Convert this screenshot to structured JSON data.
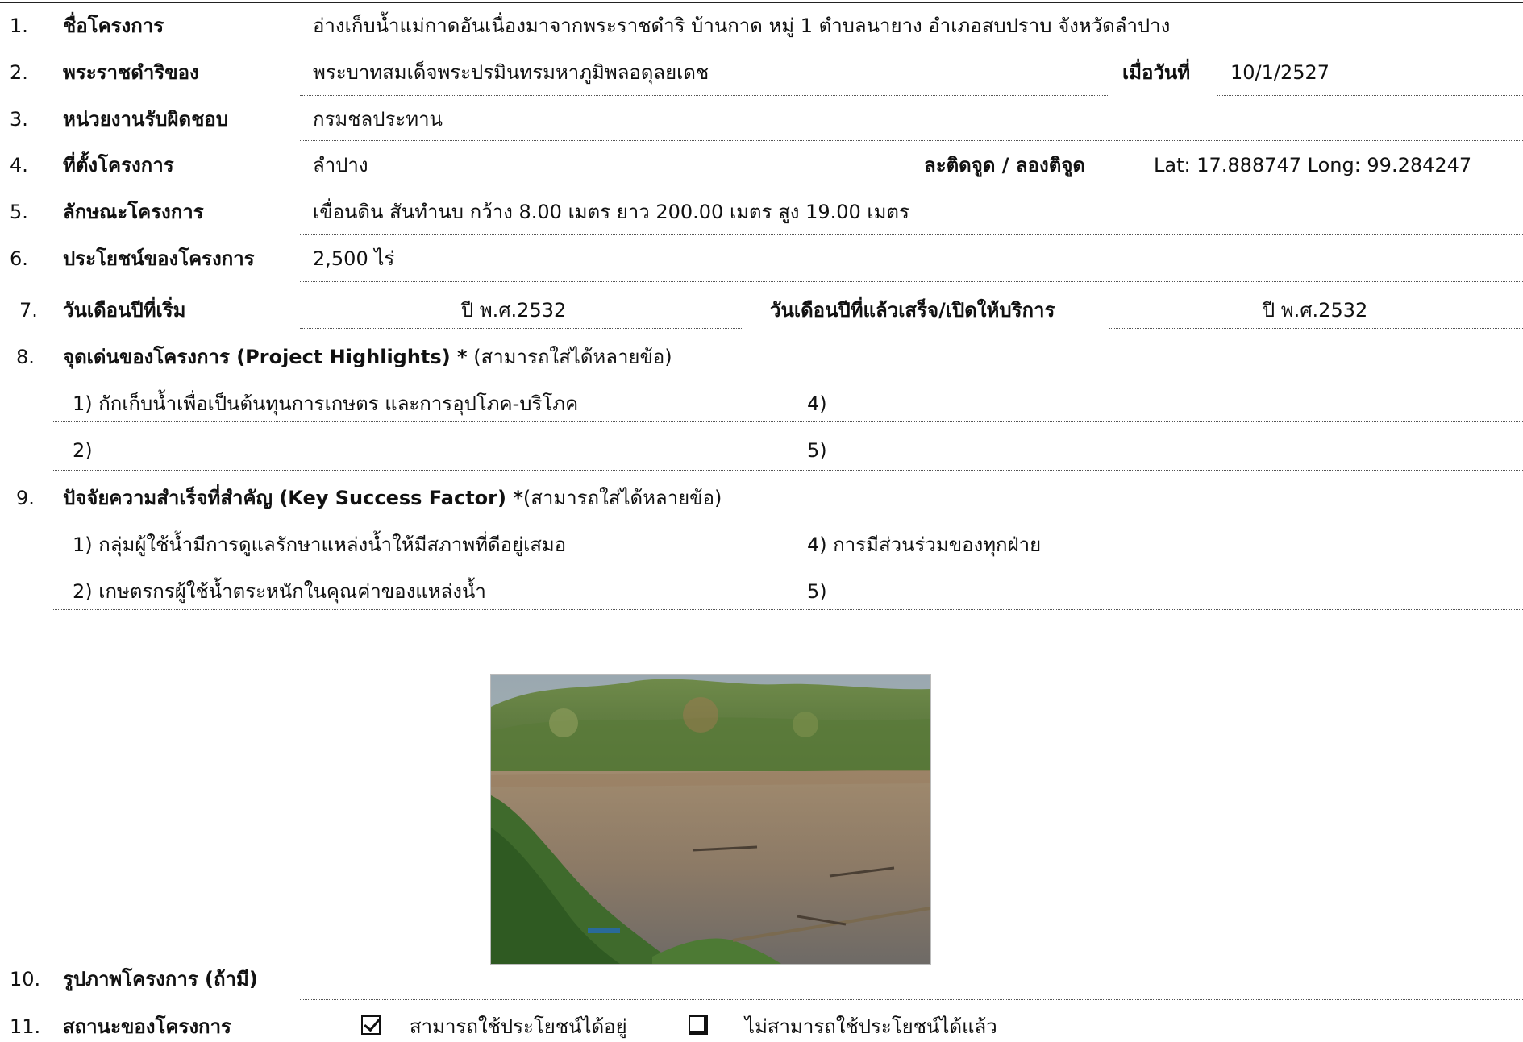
{
  "fields": {
    "f1": {
      "no": "1.",
      "label": "ชื่อโครงการ",
      "value": "อ่างเก็บน้ำแม่กาดอันเนื่องมาจากพระราชดำริ บ้านกาด หมู่ 1 ตำบลนายาง อำเภอสบปราบ จังหวัดลำปาง"
    },
    "f2": {
      "no": "2.",
      "label": "พระราชดำริของ",
      "value": "พระบาทสมเด็จพระปรมินทรมหาภูมิพลอดุลยเดช",
      "label2": "เมื่อวันที่",
      "value2": "10/1/2527"
    },
    "f3": {
      "no": "3.",
      "label": "หน่วยงานรับผิดชอบ",
      "value": "กรมชลประทาน"
    },
    "f4": {
      "no": "4.",
      "label": "ที่ตั้งโครงการ",
      "value": "ลำปาง",
      "label2": "ละติดจูด / ลองติจูด",
      "value2": "Lat: 17.888747  Long: 99.284247"
    },
    "f5": {
      "no": "5.",
      "label": "ลักษณะโครงการ",
      "value": "เขื่อนดิน สันทำนบ กว้าง 8.00 เมตร ยาว 200.00 เมตร สูง 19.00 เมตร"
    },
    "f6": {
      "no": "6.",
      "label": "ประโยชน์ของโครงการ",
      "value": "2,500 ไร่"
    },
    "f7": {
      "no": "7.",
      "label": "วันเดือนปีที่เริ่ม",
      "value": "ปี พ.ศ.2532",
      "label2": "วันเดือนปีที่แล้วเสร็จ/เปิดให้บริการ",
      "value2": "ปี พ.ศ.2532"
    }
  },
  "highlights": {
    "no": "8.",
    "title": "จุดเด่นของโครงการ (Project Highlights) *",
    "note": " (สามารถใส่ได้หลายข้อ)",
    "items": [
      "1) กักเก็บน้ำเพื่อเป็นต้นทุนการเกษตร และการอุปโภค-บริโภค",
      "2)",
      "4)",
      "5)"
    ]
  },
  "success": {
    "no": "9.",
    "title": "ปัจจัยความสำเร็จที่สำคัญ (Key Success Factor) *",
    "note": "(สามารถใส่ได้หลายข้อ)",
    "items": [
      "1) กลุ่มผู้ใช้น้ำมีการดูแลรักษาแหล่งน้ำให้มีสภาพที่ดีอยู่เสมอ",
      "2) เกษตรกรผู้ใช้น้ำตระหนักในคุณค่าของแหล่งน้ำ",
      "4) การมีส่วนร่วมของทุกฝ่าย",
      "5)"
    ]
  },
  "photo": {
    "no": "10.",
    "label": "รูปภาพโครงการ (ถ้ามี)"
  },
  "status": {
    "no": "11.",
    "label": "สถานะของโครงการ",
    "options": [
      {
        "label": "สามารถใช้ประโยชน์ได้อยู่",
        "checked": true
      },
      {
        "label": "ไม่สามารถใช้ประโยชน์ได้แล้ว",
        "checked": false
      }
    ]
  }
}
